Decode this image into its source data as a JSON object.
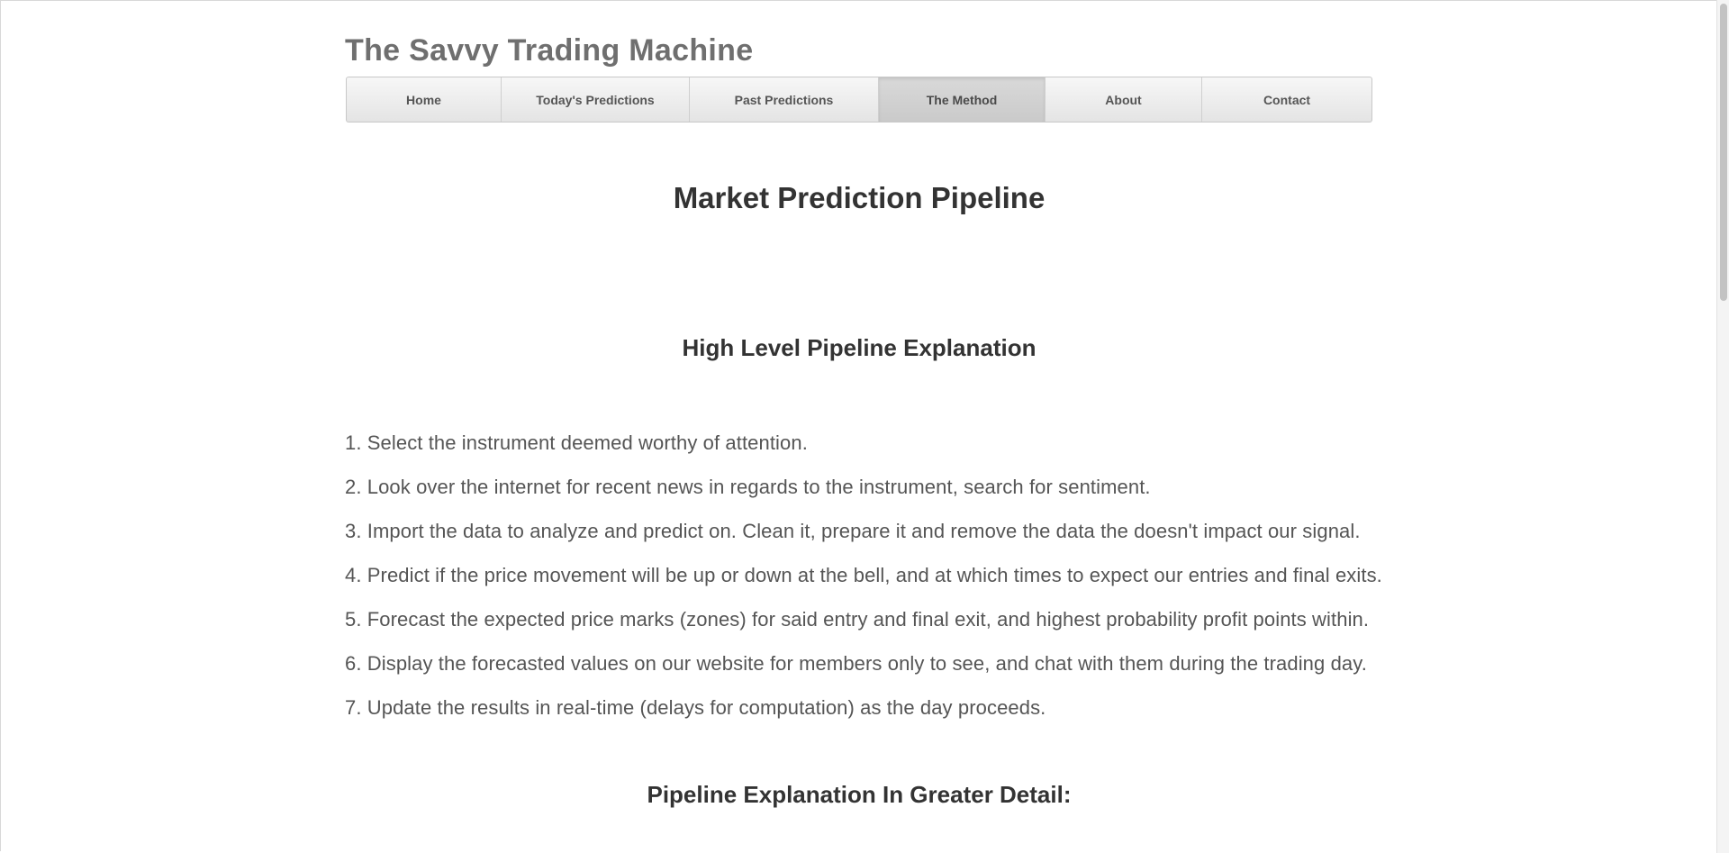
{
  "site": {
    "title": "The Savvy Trading Machine"
  },
  "nav": {
    "items": [
      {
        "label": "Home",
        "active": false
      },
      {
        "label": "Today's Predictions",
        "active": false
      },
      {
        "label": "Past Predictions",
        "active": false
      },
      {
        "label": "The Method",
        "active": true
      },
      {
        "label": "About",
        "active": false
      },
      {
        "label": "Contact",
        "active": false
      }
    ]
  },
  "main": {
    "heading": "Market Prediction Pipeline",
    "overview_heading": "High Level Pipeline Explanation",
    "steps": [
      "1. Select the instrument deemed worthy of attention.",
      "2. Look over the internet for recent news in regards to the instrument, search for sentiment.",
      "3. Import the data to analyze and predict on. Clean it, prepare it and remove the data the doesn't impact our signal.",
      "4. Predict if the price movement will be up or down at the bell, and at which times to expect our entries and final exits.",
      "5. Forecast the expected price marks (zones) for said entry and final exit, and highest probability profit points within.",
      "6. Display the forecasted values on our website for members only to see, and chat with them during the trading day.",
      "7. Update the results in real-time (delays for computation) as the day proceeds."
    ],
    "detail_heading": "Pipeline Explanation In Greater Detail:"
  },
  "colors": {
    "title_gray": "#6f6f6f",
    "heading_dark": "#333333",
    "body_text": "#555555",
    "nav_active_bg": "#cacaca"
  }
}
